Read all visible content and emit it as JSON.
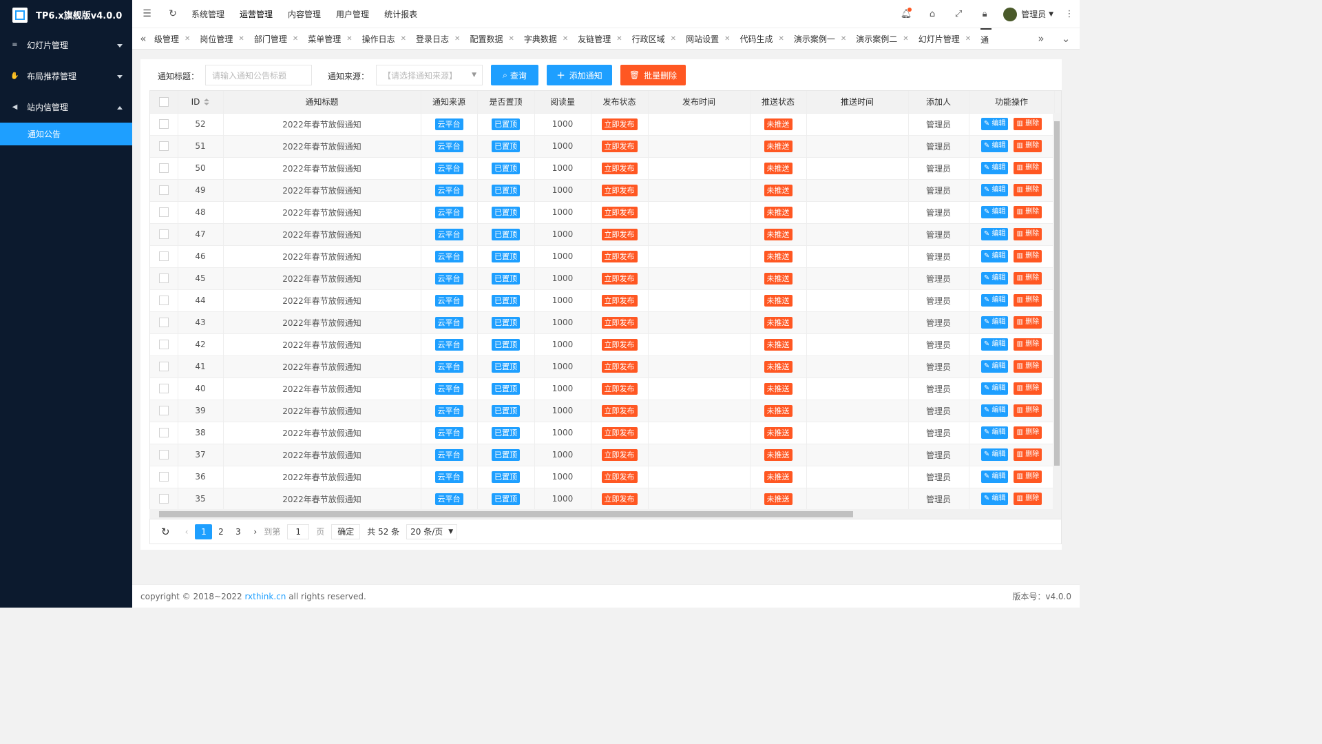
{
  "app": {
    "title": "TP6.x旗舰版v4.0.0"
  },
  "sidebar": {
    "items": [
      {
        "label": "幻灯片管理",
        "icon": "layers-icon",
        "expanded": false
      },
      {
        "label": "布局推荐管理",
        "icon": "hand-icon",
        "expanded": false
      },
      {
        "label": "站内信管理",
        "icon": "speaker-icon",
        "expanded": true
      }
    ],
    "active_sub": "通知公告"
  },
  "header": {
    "nav": [
      "系统管理",
      "运营管理",
      "内容管理",
      "用户管理",
      "统计报表"
    ],
    "active_nav": "运营管理",
    "user": "管理员"
  },
  "tabs": [
    "级管理",
    "岗位管理",
    "部门管理",
    "菜单管理",
    "操作日志",
    "登录日志",
    "配置数据",
    "字典数据",
    "友链管理",
    "行政区域",
    "网站设置",
    "代码生成",
    "演示案例一",
    "演示案例二",
    "幻灯片管理",
    "通"
  ],
  "search": {
    "title_label": "通知标题：",
    "title_placeholder": "请输入通知公告标题",
    "source_label": "通知来源：",
    "source_placeholder": "【请选择通知来源】",
    "query_btn": "查询",
    "add_btn": "添加通知",
    "batch_delete_btn": "批量删除"
  },
  "table": {
    "headers": [
      "ID",
      "通知标题",
      "通知来源",
      "是否置顶",
      "阅读量",
      "发布状态",
      "发布时间",
      "推送状态",
      "推送时间",
      "添加人",
      "功能操作"
    ],
    "row_template": {
      "title": "2022年春节放假通知",
      "source": "云平台",
      "top": "已置顶",
      "views": "1000",
      "status": "立即发布",
      "publish_time": "",
      "push_status": "未推送",
      "push_time": "",
      "adder": "管理员",
      "edit": "编辑",
      "delete": "删除"
    },
    "ids": [
      "52",
      "51",
      "50",
      "49",
      "48",
      "47",
      "46",
      "45",
      "44",
      "43",
      "42",
      "41",
      "40",
      "39",
      "38",
      "37",
      "36",
      "35"
    ]
  },
  "pager": {
    "pages": [
      "1",
      "2",
      "3"
    ],
    "current": "1",
    "goto_label": "到第",
    "goto_value": "1",
    "page_unit": "页",
    "confirm": "确定",
    "total": "共 52 条",
    "page_size": "20 条/页"
  },
  "footer": {
    "copyright_pre": "copyright © 2018~2022 ",
    "link": "rxthink.cn",
    "copyright_post": " all rights reserved.",
    "version": "版本号：v4.0.0"
  },
  "colors": {
    "primary": "#1e9fff",
    "danger": "#ff5722",
    "sidebar": "#0c1a2e"
  }
}
